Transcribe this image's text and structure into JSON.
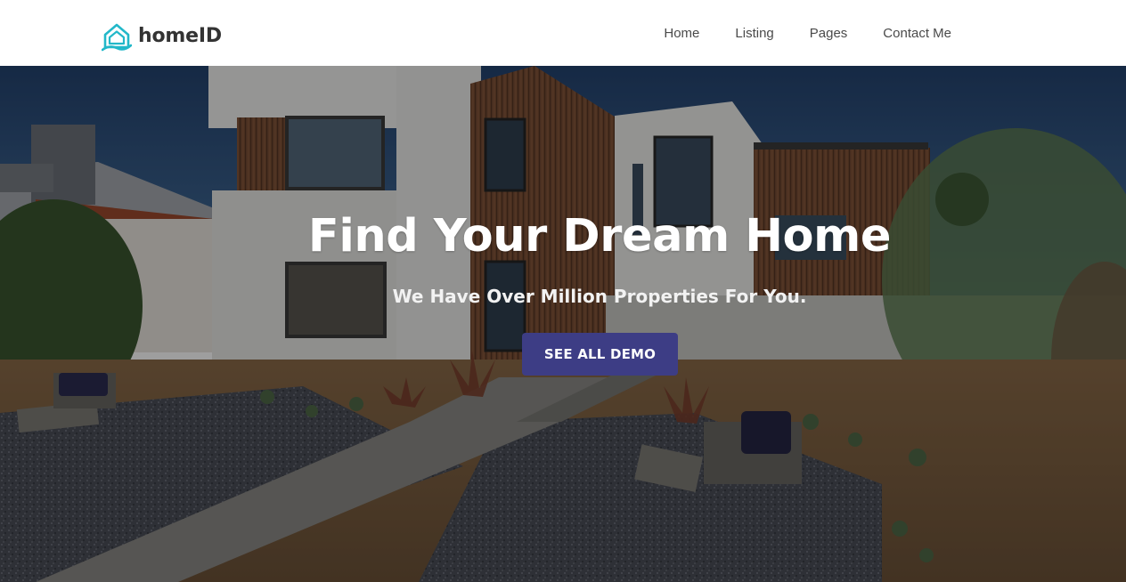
{
  "brand": {
    "name_part1": "home",
    "name_part2": "ID",
    "icon": "house-logo-icon",
    "accent_color": "#22b8c9"
  },
  "nav": {
    "items": [
      {
        "label": "Home"
      },
      {
        "label": "Listing"
      },
      {
        "label": "Pages"
      },
      {
        "label": "Contact Me"
      }
    ]
  },
  "hero": {
    "title": "Find Your Dream Home",
    "subtitle": "We Have Over Million Properties For You.",
    "cta_label": "SEE ALL DEMO",
    "cta_color": "#3d3d85",
    "background_image": "modern-house-exterior-photo"
  }
}
